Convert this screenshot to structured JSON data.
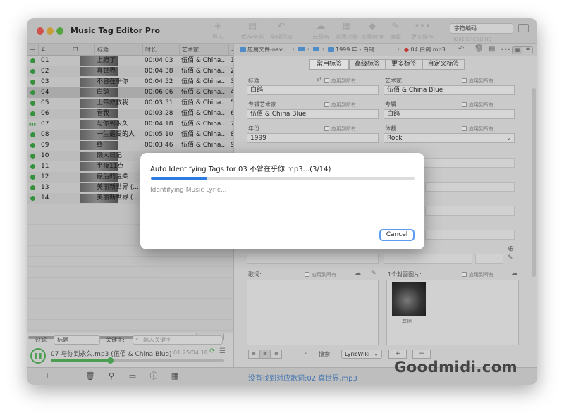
{
  "app": {
    "title": "Music Tag Editor Pro"
  },
  "toolbar": {
    "items": [
      {
        "icon": "plus",
        "label": "导入"
      },
      {
        "icon": "calendar",
        "label": "保存全部"
      },
      {
        "icon": "undo",
        "label": "全部回滚"
      },
      {
        "icon": "cloud",
        "label": "云服务"
      },
      {
        "icon": "form",
        "label": "常用功能"
      },
      {
        "icon": "tag",
        "label": "大量替换"
      },
      {
        "icon": "pencil",
        "label": "编辑"
      },
      {
        "icon": "more",
        "label": "更多操作"
      }
    ],
    "encoding_value": "字符编码",
    "encoding_label": "Text Encoding"
  },
  "track_table": {
    "columns": [
      "#",
      "",
      "标题",
      "时长",
      "艺术家",
      "#"
    ],
    "rows": [
      {
        "num": "01",
        "title": "上瘾了",
        "duration": "00:04:03",
        "artist": "伍佰 & China...",
        "track": "1",
        "status": "dot"
      },
      {
        "num": "02",
        "title": "真世界",
        "duration": "00:04:38",
        "artist": "伍佰 & China...",
        "track": "2",
        "status": "dot"
      },
      {
        "num": "03",
        "title": "不曾在乎你",
        "duration": "00:04:52",
        "artist": "伍佰 & China...",
        "track": "3",
        "status": "dot"
      },
      {
        "num": "04",
        "title": "白鸽",
        "duration": "00:06:06",
        "artist": "伍佰 & China...",
        "track": "4",
        "status": "dot"
      },
      {
        "num": "05",
        "title": "上帝救救我",
        "duration": "00:03:51",
        "artist": "伍佰 & China...",
        "track": "5",
        "status": "dot"
      },
      {
        "num": "06",
        "title": "看我",
        "duration": "00:03:28",
        "artist": "伍佰 & China...",
        "track": "6",
        "status": "dot"
      },
      {
        "num": "07",
        "title": "与你到永久",
        "duration": "00:04:18",
        "artist": "伍佰 & China...",
        "track": "7",
        "status": "bars"
      },
      {
        "num": "08",
        "title": "一生最爱的人",
        "duration": "00:05:10",
        "artist": "伍佰 & China...",
        "track": "8",
        "status": "dot"
      },
      {
        "num": "09",
        "title": "终于",
        "duration": "00:03:46",
        "artist": "伍佰 & China...",
        "track": "9",
        "status": "dot"
      },
      {
        "num": "10",
        "title": "懒人日记",
        "duration": "",
        "artist": "",
        "track": "",
        "status": "dot"
      },
      {
        "num": "11",
        "title": "半夜11点",
        "duration": "",
        "artist": "",
        "track": "",
        "status": "dot"
      },
      {
        "num": "12",
        "title": "最后的温柔",
        "duration": "",
        "artist": "",
        "track": "",
        "status": "dot"
      },
      {
        "num": "13",
        "title": "美丽新世界 (...",
        "duration": "",
        "artist": "",
        "track": "",
        "status": "dot"
      },
      {
        "num": "14",
        "title": "美丽新世界 (...",
        "duration": "",
        "artist": "",
        "track": "",
        "status": "dot"
      }
    ],
    "selected_num": "04"
  },
  "filter": {
    "label": "过滤",
    "field_value": "标题",
    "keyword_label": "关键字:",
    "search_placeholder": "输入关键字"
  },
  "player": {
    "now_playing": "07 与你到永久.mp3 (伍佰 & China Blue)",
    "time": "01:25/04:18",
    "progress": 0.34
  },
  "bottom_bar": {
    "buttons": [
      "+",
      "−",
      "trash",
      "search",
      "folder",
      "info",
      "grid"
    ],
    "status": "没有找到对应歌词:02 真世界.mp3"
  },
  "path_bar": {
    "segments": [
      "应用文件-navi",
      "1999 年 - 白鸽",
      "04 白鸽.mp3"
    ]
  },
  "tag_tabs": [
    "常用标签",
    "高级标签",
    "更多标签",
    "自定义标签"
  ],
  "tag_fields": {
    "title_label": "标题:",
    "title_value": "白鸽",
    "artist_label": "艺术家:",
    "artist_value": "伍佰 & China Blue",
    "album_artist_label": "专辑艺术家:",
    "album_artist_value": "伍佰 & China Blue",
    "album_label": "专辑:",
    "album_value": "白鸽",
    "year_label": "年份:",
    "year_value": "1999",
    "genre_label": "体裁:",
    "genre_value": "Rock",
    "apply_all": "应用到所有",
    "lyrics_label": "歌词:",
    "cover_label": "1个封面图片:",
    "cover_caption": "其他",
    "search_label": "搜索",
    "lyric_source": "LyricWiki"
  },
  "dialog": {
    "title": "Auto Identifying Tags for 03 不曾在乎你.mp3...(3/14)",
    "status": "Identifying Music Lyric...",
    "progress": 0.214,
    "cancel_label": "Cancel"
  },
  "watermark": "Goodmidi.com",
  "colors": {
    "accent_blue": "#2c7be5",
    "play_green": "#3fa447",
    "status_blue": "#4f86c8"
  }
}
